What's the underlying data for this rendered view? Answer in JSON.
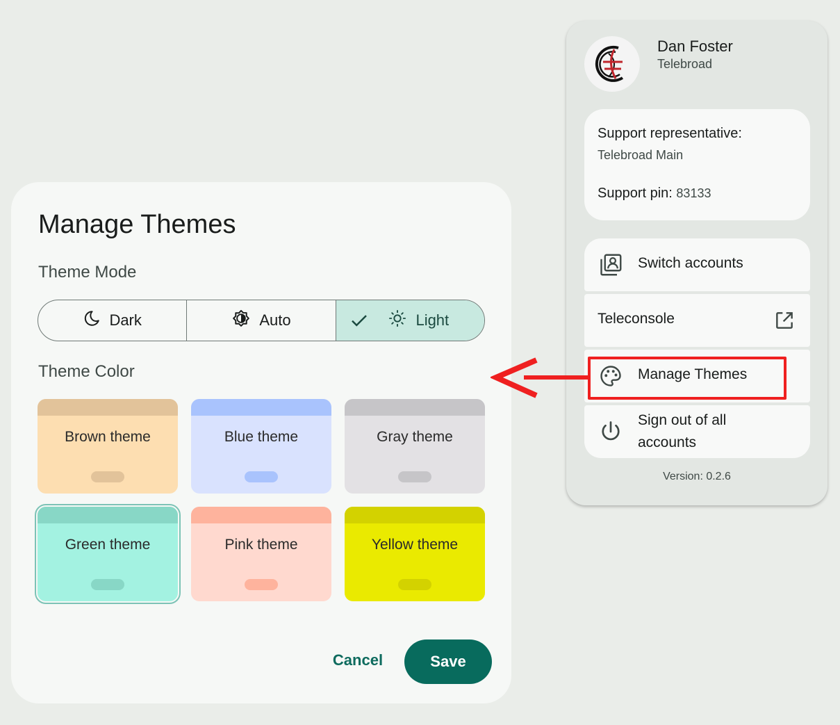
{
  "dialog": {
    "title": "Manage Themes",
    "theme_mode_label": "Theme Mode",
    "modes": [
      {
        "label": "Dark",
        "icon": "moon-icon",
        "selected": false
      },
      {
        "label": "Auto",
        "icon": "brightness-auto-icon",
        "selected": false
      },
      {
        "label": "Light",
        "icon": "sun-icon",
        "selected": true
      }
    ],
    "theme_color_label": "Theme Color",
    "themes": [
      {
        "name": "Brown theme",
        "bar": "#e2c39a",
        "body": "#fddeb1",
        "pill": "#e2c39a",
        "selected": false
      },
      {
        "name": "Blue theme",
        "bar": "#a9c3fd",
        "body": "#d9e2fe",
        "pill": "#a9c3fd",
        "selected": false
      },
      {
        "name": "Gray theme",
        "bar": "#c6c5c8",
        "body": "#e3e1e4",
        "pill": "#c6c5c8",
        "selected": false
      },
      {
        "name": "Green theme",
        "bar": "#88d7c6",
        "body": "#a3f2e1",
        "pill": "#88d7c6",
        "selected": true
      },
      {
        "name": "Pink theme",
        "bar": "#feb39d",
        "body": "#ffd9cf",
        "pill": "#feb39d",
        "selected": false
      },
      {
        "name": "Yellow theme",
        "bar": "#d3d200",
        "body": "#eaea00",
        "pill": "#d3d200",
        "selected": false
      }
    ],
    "cancel_label": "Cancel",
    "save_label": "Save"
  },
  "account": {
    "name": "Dan Foster",
    "org": "Telebroad",
    "support_rep_label": "Support representative:",
    "support_rep_value": "Telebroad Main",
    "support_pin_label": "Support pin:",
    "support_pin_value": "83133",
    "menu": [
      {
        "label": "Switch accounts",
        "icon": "switch-accounts-icon"
      },
      {
        "label": "Teleconsole",
        "icon": "open-in-new-icon"
      },
      {
        "label": "Manage Themes",
        "icon": "palette-icon"
      },
      {
        "label": "Sign out of all accounts",
        "icon": "power-icon"
      }
    ],
    "version": "Version: 0.2.6"
  },
  "colors": {
    "accent": "#086b5d",
    "selected_mode_bg": "#c8e9e0",
    "annotation": "#ef2020"
  }
}
